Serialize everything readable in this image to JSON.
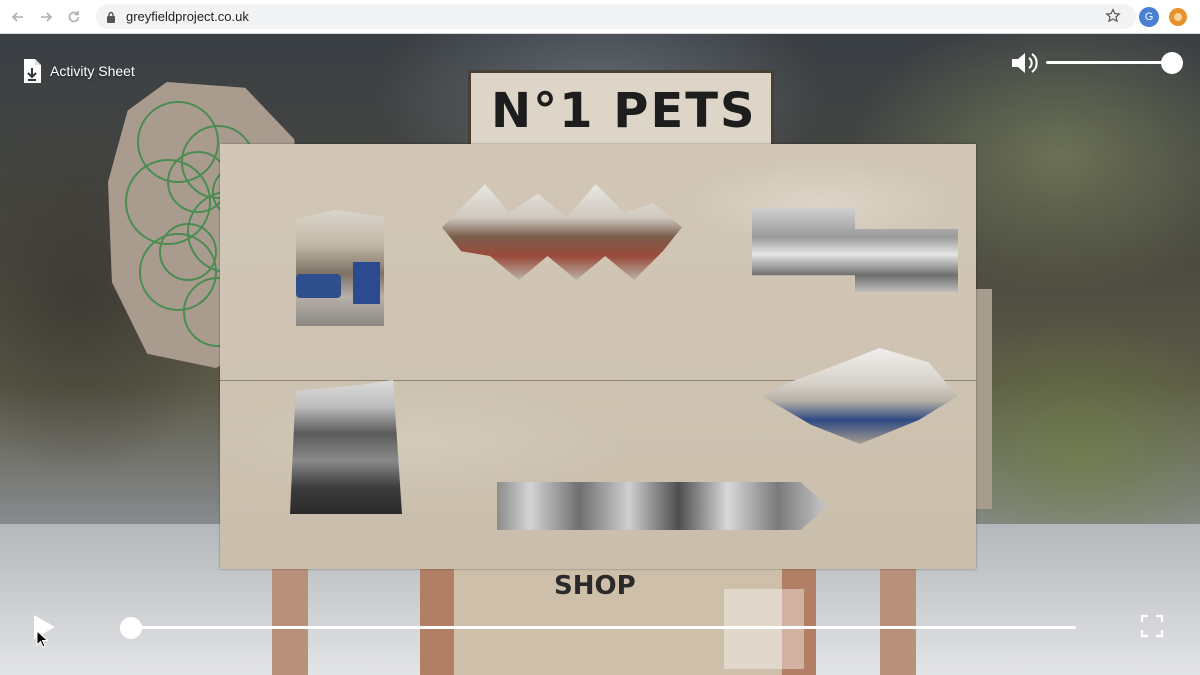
{
  "browser": {
    "url": "greyfieldproject.co.uk",
    "extension_g_label": "G"
  },
  "scene": {
    "sign_text": "N°1 PETS",
    "shop_text": "SHOP"
  },
  "overlay": {
    "activity_sheet_label": "Activity Sheet",
    "volume_level": 1.0,
    "playback_position": 0.0,
    "icons": {
      "activity": "document-download-icon",
      "volume": "speaker-icon",
      "play": "play-icon",
      "fullscreen": "fullscreen-icon"
    }
  },
  "colors": {
    "accent_white": "#ffffff",
    "panel_wood": "#cfc4b3"
  }
}
